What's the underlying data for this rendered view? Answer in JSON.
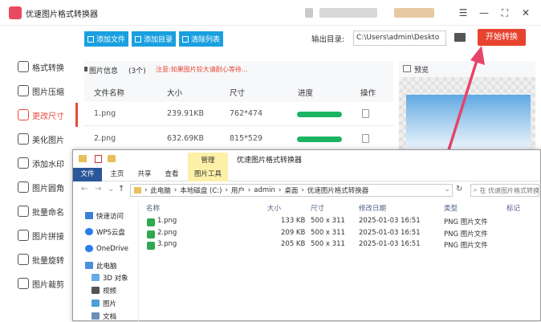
{
  "app": {
    "title": "优速图片格式转换器",
    "window_buttons": [
      "☰",
      "—",
      "⛶",
      "✕"
    ]
  },
  "sidebar": {
    "items": [
      {
        "label": "格式转换",
        "icon": "format-convert-icon"
      },
      {
        "label": "图片压缩",
        "icon": "compress-icon"
      },
      {
        "label": "更改尺寸",
        "icon": "resize-icon",
        "active": true
      },
      {
        "label": "美化图片",
        "icon": "beautify-icon"
      },
      {
        "label": "添加水印",
        "icon": "watermark-icon"
      },
      {
        "label": "图片圆角",
        "icon": "rounded-corner-icon"
      },
      {
        "label": "批量命名",
        "icon": "rename-icon"
      },
      {
        "label": "图片拼接",
        "icon": "stitch-icon"
      },
      {
        "label": "批量旋转",
        "icon": "rotate-icon"
      },
      {
        "label": "图片裁剪",
        "icon": "crop-icon"
      }
    ]
  },
  "toolbar": {
    "add_file": "添加文件",
    "add_folder": "添加目录",
    "clear_list": "清除列表",
    "output_label": "输出目录:",
    "output_path": "C:\\Users\\admin\\Deskto",
    "start_button": "开始转换"
  },
  "image_info": {
    "title": "图片信息",
    "count": "(3个)",
    "note": "注意:如果图片较大请耐心等待...",
    "columns": [
      "文件名称",
      "大小",
      "尺寸",
      "进度",
      "操作"
    ],
    "rows": [
      {
        "name": "1.png",
        "size": "239.91KB",
        "dims": "762*474",
        "progress": 1.0
      },
      {
        "name": "2.png",
        "size": "632.69KB",
        "dims": "815*529",
        "progress": 1.0
      }
    ]
  },
  "preview": {
    "label": "预览"
  },
  "explorer": {
    "manage_tab": "管理",
    "title": "优速图片格式转换器",
    "ribbon_tabs": [
      "文件",
      "主页",
      "共享",
      "查看",
      "图片工具"
    ],
    "address": [
      "此电脑",
      "本地磁盘 (C:)",
      "用户",
      "admin",
      "桌面",
      "优速图片格式转换器"
    ],
    "search_placeholder": "在 优速图片格式转换器",
    "tree": [
      {
        "label": "快速访问",
        "color": "#3b7fd4"
      },
      {
        "label": "WPS云盘",
        "color": "#2b7de9"
      },
      {
        "label": "OneDrive",
        "color": "#2b7de9"
      },
      {
        "label": "此电脑",
        "color": "#4a90d9"
      },
      {
        "label": "3D 对象",
        "color": "#6aa9e9"
      },
      {
        "label": "视频",
        "color": "#555555"
      },
      {
        "label": "图片",
        "color": "#4aa0d8"
      },
      {
        "label": "文档",
        "color": "#6b8fb5"
      }
    ],
    "columns": [
      "名称",
      "大小",
      "尺寸",
      "修改日期",
      "类型",
      "标记"
    ],
    "files": [
      {
        "name": "1.png",
        "size": "133 KB",
        "dims": "500 x 311",
        "date": "2025-01-03 16:51",
        "type": "PNG 图片文件"
      },
      {
        "name": "2.png",
        "size": "209 KB",
        "dims": "500 x 311",
        "date": "2025-01-03 16:51",
        "type": "PNG 图片文件"
      },
      {
        "name": "3.png",
        "size": "205 KB",
        "dims": "500 x 311",
        "date": "2025-01-03 16:51",
        "type": "PNG 图片文件"
      }
    ]
  },
  "colors": {
    "accent_red": "#e8432f",
    "toolbar_blue": "#1a9fe0",
    "progress_green": "#1bb462"
  }
}
